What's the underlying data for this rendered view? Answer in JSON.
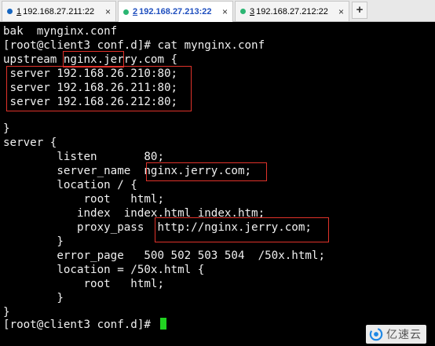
{
  "tabs": [
    {
      "number": "1",
      "host": "192.168.27.211:22",
      "status_color": "#1565c0",
      "active": false
    },
    {
      "number": "2",
      "host": "192.168.27.213:22",
      "status_color": "#2bb673",
      "active": true
    },
    {
      "number": "3",
      "host": "192.168.27.212:22",
      "status_color": "#2bb673",
      "active": false
    }
  ],
  "tab_close_glyph": "×",
  "new_tab_glyph": "+",
  "terminal": {
    "lines": [
      "bak  mynginx.conf",
      "[root@client3 conf.d]# cat mynginx.conf",
      "upstream nginx.jerry.com {",
      " server 192.168.26.210:80;",
      " server 192.168.26.211:80;",
      " server 192.168.26.212:80;",
      "",
      "}",
      "server {",
      "        listen       80;",
      "        server_name  nginx.jerry.com;",
      "        location / {",
      "            root   html;",
      "           index  index.html index.htm;",
      "           proxy_pass  http://nginx.jerry.com;",
      "        }",
      "        error_page   500 502 503 504  /50x.html;",
      "        location = /50x.html {",
      "            root   html;",
      "        }",
      "}",
      "[root@client3 conf.d]# "
    ],
    "text_color": "#f0f0f0",
    "cursor_color": "#21d321",
    "highlight_color": "#e0322a"
  },
  "watermark": {
    "text": "亿速云",
    "logo_icon": "yisu-cloud-logo-icon"
  }
}
